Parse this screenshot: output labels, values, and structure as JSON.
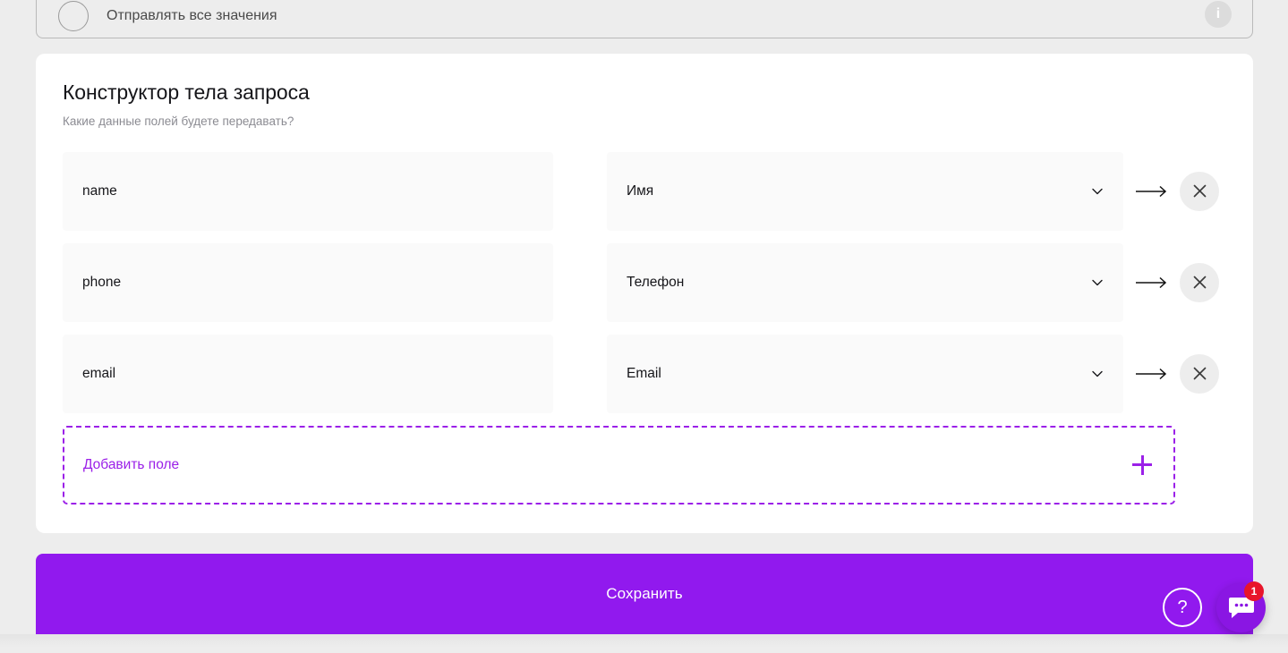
{
  "page": {
    "background_color": "#ededed",
    "accent_color": "#9119ee"
  },
  "top_card": {
    "option_label": "Отправлять все значения",
    "radio_name": "radio-unselected",
    "info_icon_label": "i"
  },
  "request_body_builder": {
    "title": "Конструктор тела запроса",
    "subtitle": "Какие данные полей будете передавать?",
    "rows": [
      {
        "key": "name",
        "mapped_value": "Имя",
        "arrow_icon": "arrow-right-icon",
        "chevron_icon": "chevron-down-icon",
        "remove_icon": "close-icon"
      },
      {
        "key": "phone",
        "mapped_value": "Телефон",
        "arrow_icon": "arrow-right-icon",
        "chevron_icon": "chevron-down-icon",
        "remove_icon": "close-icon"
      },
      {
        "key": "email",
        "mapped_value": "Email",
        "arrow_icon": "arrow-right-icon",
        "chevron_icon": "chevron-down-icon",
        "remove_icon": "close-icon"
      }
    ],
    "add_field": {
      "label": "Добавить поле",
      "icon": "plus-icon",
      "border_color": "#9b20e8"
    }
  },
  "footer": {
    "save_label": "Сохранить"
  },
  "widgets": {
    "help": {
      "label": "?",
      "icon": "question-mark-icon"
    },
    "chat": {
      "icon": "chat-bubble-icon",
      "badge_count": "1",
      "badge_color": "#e8152a"
    }
  }
}
